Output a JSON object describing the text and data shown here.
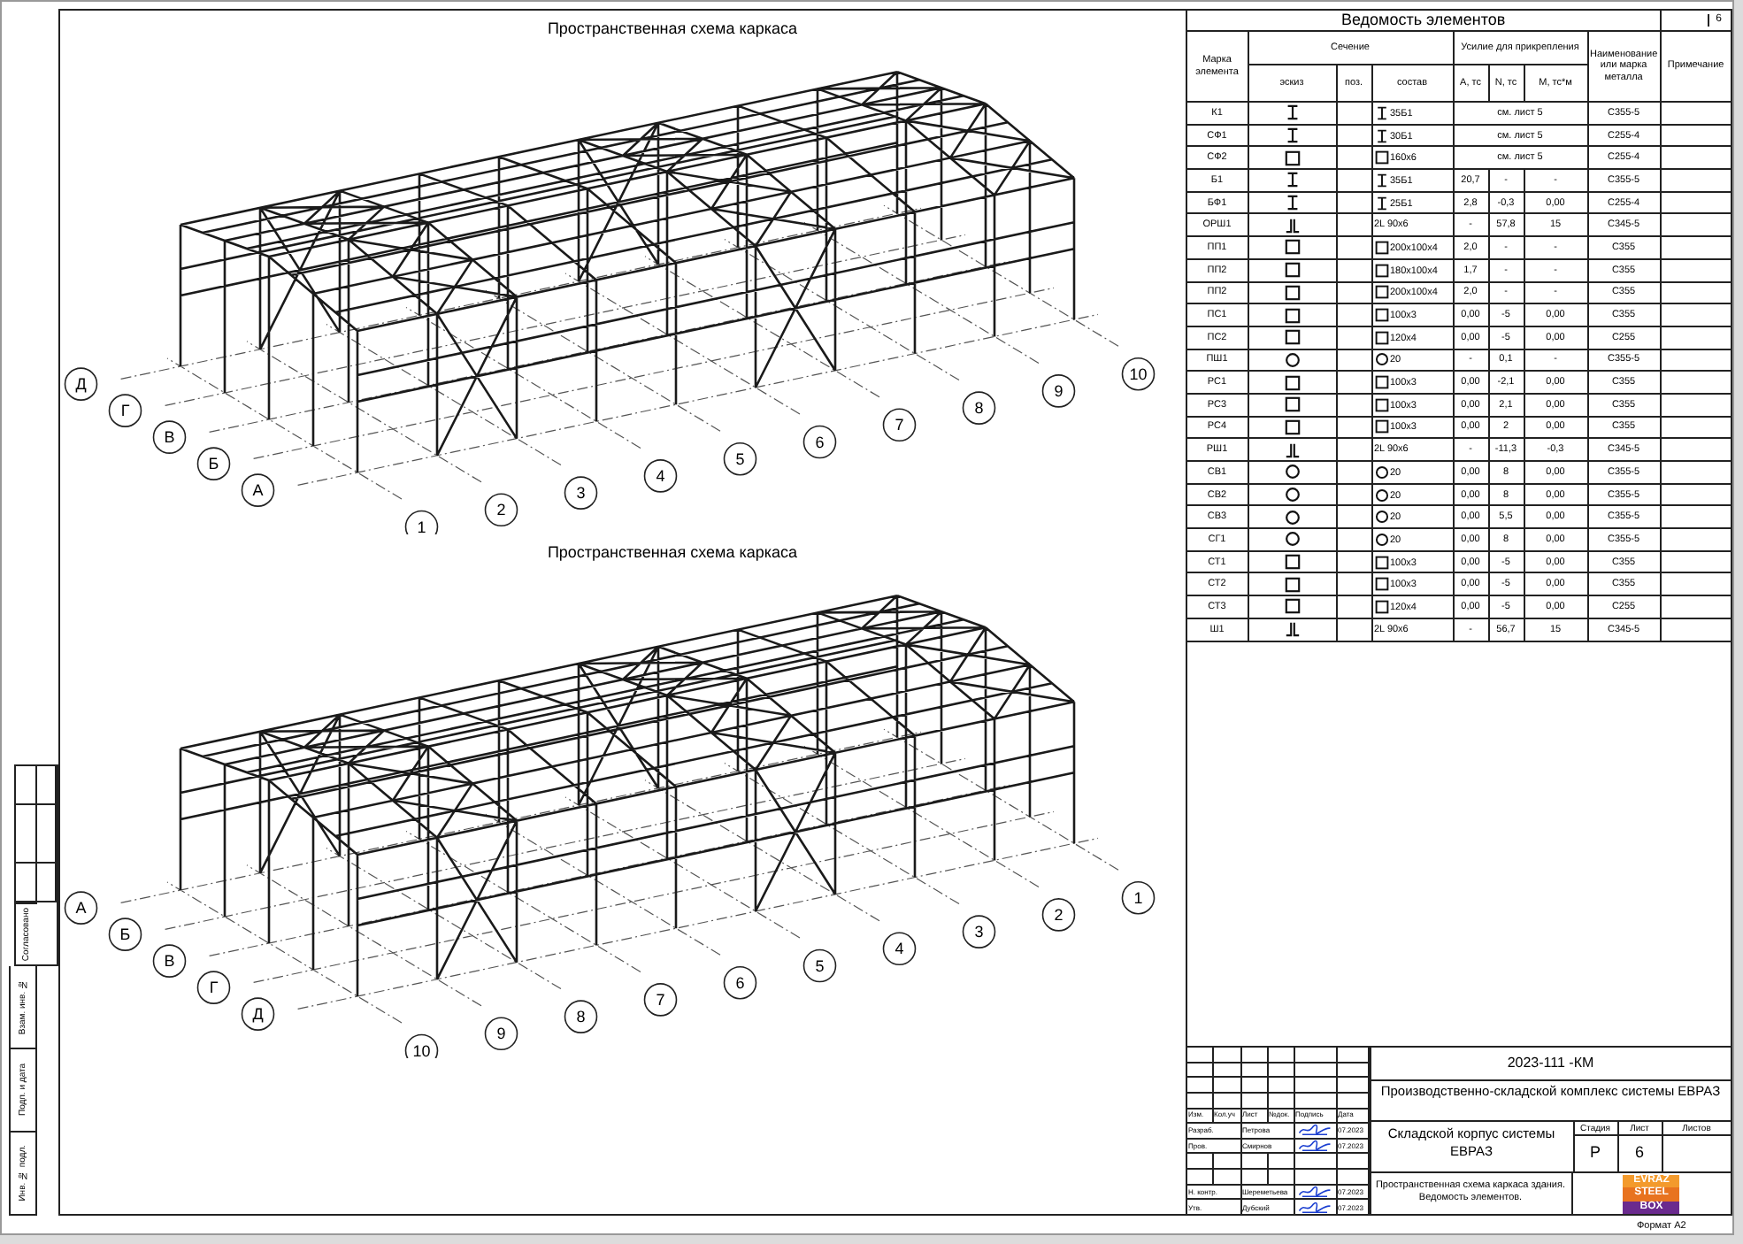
{
  "side_stamp": {
    "approval_label": "Согласовано",
    "fields": [
      "Взам. инв. №",
      "Подп. и дата",
      "Инв. № подл."
    ]
  },
  "drawings": [
    {
      "title": "Пространственная схема каркаса",
      "row_axes": [
        "Д",
        "Г",
        "В",
        "Б",
        "А"
      ],
      "column_axes": [
        "1",
        "2",
        "3",
        "4",
        "5",
        "6",
        "7",
        "8",
        "9",
        "10"
      ]
    },
    {
      "title": "Пространственная схема каркаса",
      "row_axes": [
        "А",
        "Б",
        "В",
        "Г",
        "Д"
      ],
      "column_axes": [
        "10",
        "9",
        "8",
        "7",
        "6",
        "5",
        "4",
        "3",
        "2",
        "1"
      ]
    }
  ],
  "table": {
    "title": "Ведомость элементов",
    "sheet_number": "6",
    "columns": {
      "mark": "Марка элемента",
      "section": "Сечение",
      "sketch": "эскиз",
      "position": "поз.",
      "composition": "состав",
      "forces": "Усилие для прикрепления",
      "a": "А, тс",
      "n": "N, тс",
      "m": "M, тс*м",
      "steel": "Наименование или марка металла",
      "note": "Примечание"
    },
    "rows": [
      {
        "mark": "К1",
        "kind": "i-beam",
        "composition": "35Б1",
        "forces_note": "см. лист 5",
        "steel": "С355-5"
      },
      {
        "mark": "СФ1",
        "kind": "i-beam",
        "composition": "30Б1",
        "forces_note": "см. лист 5",
        "steel": "С255-4"
      },
      {
        "mark": "СФ2",
        "kind": "square-tube",
        "composition": "160х6",
        "forces_note": "см. лист 5",
        "steel": "С255-4"
      },
      {
        "mark": "Б1",
        "kind": "i-beam",
        "composition": "35Б1",
        "a": "20,7",
        "n": "-",
        "m": "-",
        "steel": "С355-5"
      },
      {
        "mark": "БФ1",
        "kind": "i-beam",
        "composition": "25Б1",
        "a": "2,8",
        "n": "-0,3",
        "m": "0,00",
        "steel": "С255-4"
      },
      {
        "mark": "ОРШ1",
        "kind": "double-angle",
        "composition": "2L 90х6",
        "a": "-",
        "n": "57,8",
        "m": "15",
        "steel": "С345-5"
      },
      {
        "mark": "ПП1",
        "kind": "square-tube",
        "composition": "200х100х4",
        "a": "2,0",
        "n": "-",
        "m": "-",
        "steel": "С355"
      },
      {
        "mark": "ПП2",
        "kind": "square-tube",
        "composition": "180х100х4",
        "a": "1,7",
        "n": "-",
        "m": "-",
        "steel": "С355"
      },
      {
        "mark": "ПП2",
        "kind": "square-tube",
        "composition": "200х100х4",
        "a": "2,0",
        "n": "-",
        "m": "-",
        "steel": "С355"
      },
      {
        "mark": "ПС1",
        "kind": "square-tube",
        "composition": "100х3",
        "a": "0,00",
        "n": "-5",
        "m": "0,00",
        "steel": "С355"
      },
      {
        "mark": "ПС2",
        "kind": "square-tube",
        "composition": "120х4",
        "a": "0,00",
        "n": "-5",
        "m": "0,00",
        "steel": "С255"
      },
      {
        "mark": "ПШ1",
        "kind": "round-bar",
        "composition": "20",
        "a": "-",
        "n": "0,1",
        "m": "-",
        "steel": "С355-5"
      },
      {
        "mark": "РС1",
        "kind": "square-tube",
        "composition": "100х3",
        "a": "0,00",
        "n": "-2,1",
        "m": "0,00",
        "steel": "С355"
      },
      {
        "mark": "РС3",
        "kind": "square-tube",
        "composition": "100х3",
        "a": "0,00",
        "n": "2,1",
        "m": "0,00",
        "steel": "С355"
      },
      {
        "mark": "РС4",
        "kind": "square-tube",
        "composition": "100х3",
        "a": "0,00",
        "n": "2",
        "m": "0,00",
        "steel": "С355"
      },
      {
        "mark": "РШ1",
        "kind": "double-angle",
        "composition": "2L 90х6",
        "a": "-",
        "n": "-11,3",
        "m": "-0,3",
        "steel": "С345-5"
      },
      {
        "mark": "СВ1",
        "kind": "round-bar",
        "composition": "20",
        "a": "0,00",
        "n": "8",
        "m": "0,00",
        "steel": "С355-5"
      },
      {
        "mark": "СВ2",
        "kind": "round-bar",
        "composition": "20",
        "a": "0,00",
        "n": "8",
        "m": "0,00",
        "steel": "С355-5"
      },
      {
        "mark": "СВ3",
        "kind": "round-bar",
        "composition": "20",
        "a": "0,00",
        "n": "5,5",
        "m": "0,00",
        "steel": "С355-5"
      },
      {
        "mark": "СГ1",
        "kind": "round-bar",
        "composition": "20",
        "a": "0,00",
        "n": "8",
        "m": "0,00",
        "steel": "С355-5"
      },
      {
        "mark": "СТ1",
        "kind": "square-tube",
        "composition": "100х3",
        "a": "0,00",
        "n": "-5",
        "m": "0,00",
        "steel": "С355"
      },
      {
        "mark": "СТ2",
        "kind": "square-tube",
        "composition": "100х3",
        "a": "0,00",
        "n": "-5",
        "m": "0,00",
        "steel": "С355"
      },
      {
        "mark": "СТ3",
        "kind": "square-tube",
        "composition": "120х4",
        "a": "0,00",
        "n": "-5",
        "m": "0,00",
        "steel": "С255"
      },
      {
        "mark": "Ш1",
        "kind": "double-angle",
        "composition": "2L 90х6",
        "a": "-",
        "n": "56,7",
        "m": "15",
        "steel": "С345-5"
      }
    ]
  },
  "title_block": {
    "document_code": "2023-111 -КМ",
    "project": "Производственно-складской комплекс системы ЕВРАЗ",
    "building": "Складской корпус системы ЕВРАЗ",
    "sheet_title": "Пространственная схема каркаса здания. Ведомость элементов.",
    "revision_headers": [
      "Изм.",
      "Кол.уч",
      "Лист",
      "№док.",
      "Подпись",
      "Дата"
    ],
    "developers": [
      {
        "role": "Разраб.",
        "name": "Петрова",
        "date": "07.2023"
      },
      {
        "role": "Пров.",
        "name": "Смирнов",
        "date": "07.2023"
      }
    ],
    "approvers": [
      {
        "role": "Н. контр.",
        "name": "Шереметьева",
        "date": "07.2023"
      },
      {
        "role": "Утв.",
        "name": "Дубский",
        "date": "07.2023"
      }
    ],
    "stage_label": "Стадия",
    "sheet_label": "Лист",
    "sheets_label": "Листов",
    "stage": "Р",
    "sheet": "6",
    "logo": [
      "EVRAZ",
      "STEEL",
      "BOX"
    ],
    "format": "Формат А2"
  }
}
